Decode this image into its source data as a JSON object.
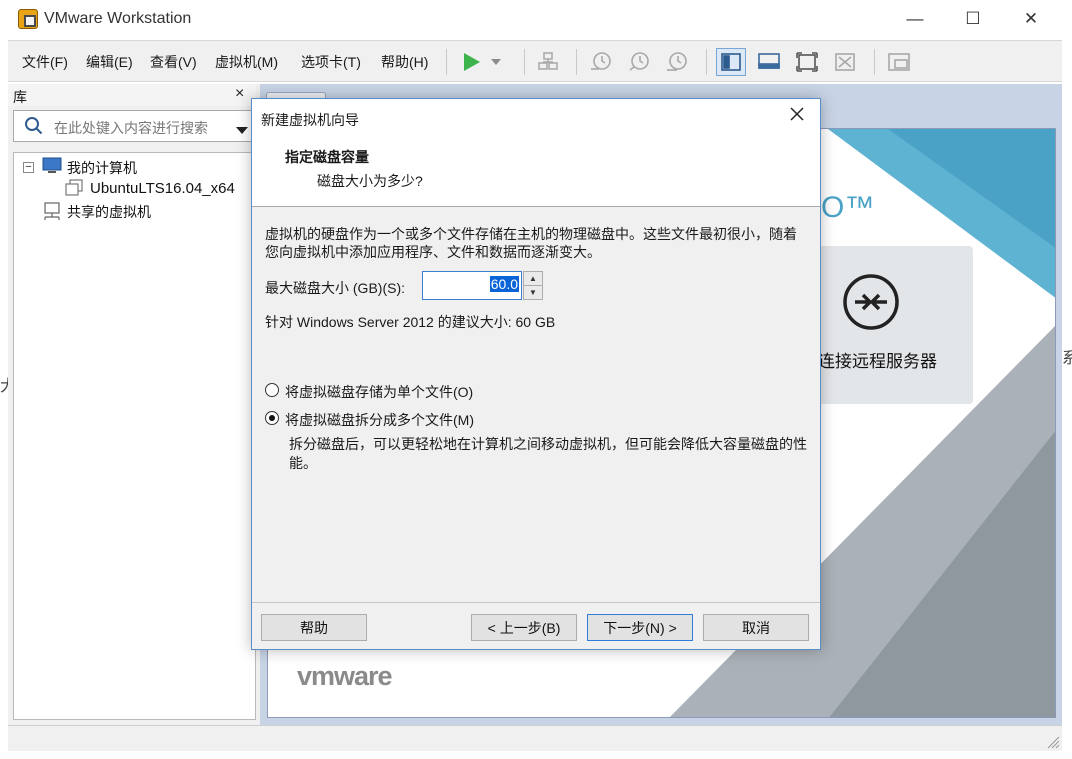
{
  "window": {
    "title": "VMware Workstation",
    "minimize_glyph": "—",
    "maximize_glyph": "☐",
    "close_glyph": "✕"
  },
  "menubar": {
    "items": [
      "文件(F)",
      "编辑(E)",
      "查看(V)",
      "虚拟机(M)",
      "选项卡(T)",
      "帮助(H)"
    ]
  },
  "toolbar": {
    "icons": [
      "play-icon",
      "dropdown-arrow-icon",
      "network-icon",
      "snapshot-icon",
      "revert-snapshot-icon",
      "snapshot-manager-icon",
      "library-view-icon",
      "console-view-icon",
      "fullscreen-icon",
      "unity-icon",
      "thumbnail-view-icon"
    ]
  },
  "library": {
    "title": "库",
    "close": "×",
    "search_placeholder": "在此处键入内容进行搜索",
    "tree": {
      "my_computer": "我的计算机",
      "vm": "UbuntuLTS16.04_x64",
      "shared": "共享的虚拟机"
    }
  },
  "home": {
    "tm": "O™",
    "remote_server": "连接远程服务器",
    "brand": "vmware",
    "right_edge": "系",
    "left_edge": "大"
  },
  "dialog": {
    "title": "新建虚拟机向导",
    "heading": "指定磁盘容量",
    "subheading": "磁盘大小为多少?",
    "description": "虚拟机的硬盘作为一个或多个文件存储在主机的物理磁盘中。这些文件最初很小，随着您向虚拟机中添加应用程序、文件和数据而逐渐变大。",
    "size_label": "最大磁盘大小 (GB)(S):",
    "size_value": "60.0",
    "recommend": "针对 Windows Server 2012 的建议大小: 60 GB",
    "radio_single": "将虚拟磁盘存储为单个文件(O)",
    "radio_split": "将虚拟磁盘拆分成多个文件(M)",
    "split_desc": "拆分磁盘后，可以更轻松地在计算机之间移动虚拟机，但可能会降低大容量磁盘的性能。",
    "help_button": "帮助",
    "back_button": "< 上一步(B)",
    "next_button": "下一步(N) >",
    "cancel_button": "取消"
  },
  "colors": {
    "accent": "#0a64d8",
    "brand_teal": "#4aa3c7",
    "brand_gray": "#9aa3ab",
    "play_green": "#3cb44b"
  }
}
